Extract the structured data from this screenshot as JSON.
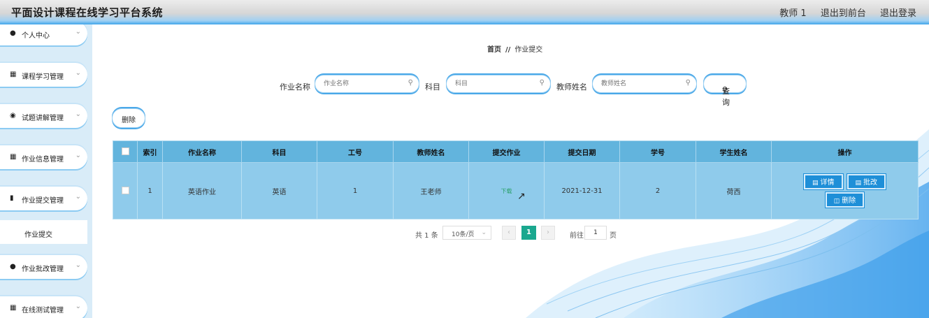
{
  "header": {
    "title": "平面设计课程在线学习平台系统",
    "user": "教师 1",
    "to_front": "退出到前台",
    "logout": "退出登录"
  },
  "sidebar": {
    "items": [
      {
        "label": "个人中心",
        "icon": "user-icon"
      },
      {
        "label": "课程学习管理",
        "icon": "grid-icon"
      },
      {
        "label": "试题讲解管理",
        "icon": "pin-icon"
      },
      {
        "label": "作业信息管理",
        "icon": "grid-icon"
      },
      {
        "label": "作业提交管理",
        "icon": "bar-chart-icon"
      },
      {
        "label": "作业批改管理",
        "icon": "user-icon"
      },
      {
        "label": "在线测试管理",
        "icon": "grid-icon"
      }
    ],
    "sub_item": "作业提交"
  },
  "breadcrumb": {
    "home": "首页",
    "separator": "//",
    "current": "作业提交"
  },
  "search": {
    "name_label": "作业名称",
    "name_placeholder": "作业名称",
    "subject_label": "科目",
    "subject_placeholder": "科目",
    "teacher_label": "教师姓名",
    "teacher_placeholder": "教师姓名",
    "query_label": "查询"
  },
  "toolbar": {
    "delete_label": "删除"
  },
  "table": {
    "headers": [
      "",
      "索引",
      "作业名称",
      "科目",
      "工号",
      "教师姓名",
      "提交作业",
      "提交日期",
      "学号",
      "学生姓名",
      "操作"
    ],
    "rows": [
      {
        "index": "1",
        "name": "英语作业",
        "subject": "英语",
        "emp_no": "1",
        "teacher": "王老师",
        "submit": "下载",
        "date": "2021-12-31",
        "student_no": "2",
        "student": "荷西"
      }
    ],
    "actions": {
      "detail": "详情",
      "review": "批改",
      "delete": "删除"
    }
  },
  "pagination": {
    "total": "共 1 条",
    "page_size": "10条/页",
    "current": "1",
    "goto_label": "前往",
    "goto_value": "1",
    "page_unit": "页"
  },
  "colors": {
    "accent": "#1e8fd8",
    "header_row": "#62b4dd",
    "body_row": "#8fcbeb",
    "pager_active": "#1aa88f"
  }
}
